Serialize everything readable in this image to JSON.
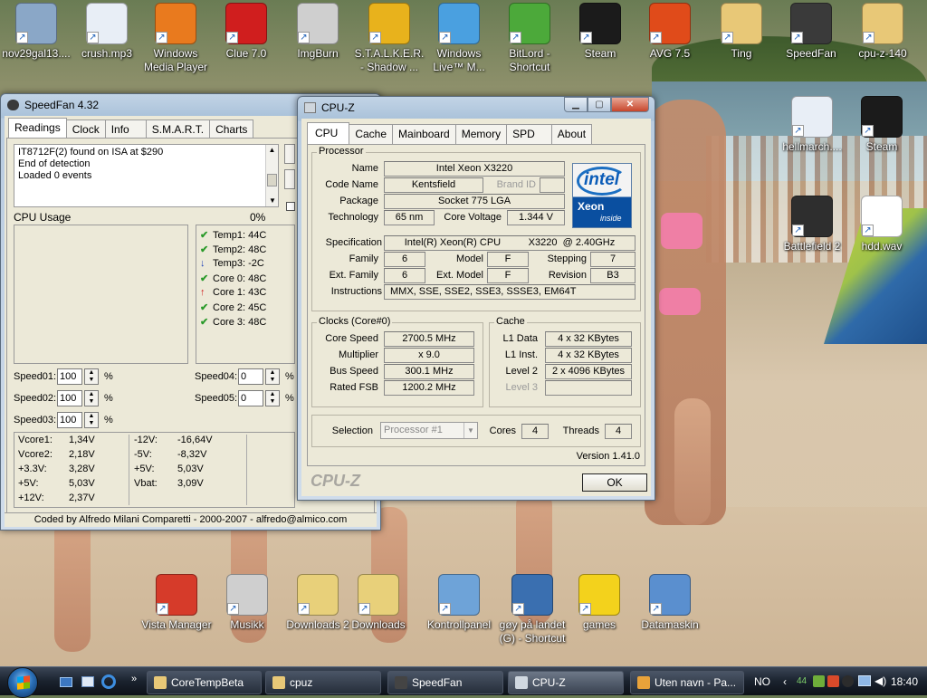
{
  "desktop_icons_top": [
    {
      "label": "nov29gal13....",
      "icon": "image-icon",
      "color": "#8aa7c7"
    },
    {
      "label": "crush.mp3",
      "icon": "audio-file-icon",
      "color": "#e8eef6"
    },
    {
      "label": "Windows Media Player",
      "icon": "media-player-icon",
      "color": "#e97a1e"
    },
    {
      "label": "Clue 7.0",
      "icon": "clue-icon",
      "color": "#d01e1e"
    },
    {
      "label": "ImgBurn",
      "icon": "disc-icon",
      "color": "#cfcfcf"
    },
    {
      "label": "S.T.A.L.K.E.R. - Shadow ...",
      "icon": "stalker-icon",
      "color": "#e8b21c"
    },
    {
      "label": "Windows Live™ M...",
      "icon": "messenger-icon",
      "color": "#4aa0e0"
    },
    {
      "label": "BitLord - Shortcut",
      "icon": "bitlord-icon",
      "color": "#4ca93a"
    },
    {
      "label": "Steam",
      "icon": "steam-icon",
      "color": "#1b1b1b"
    },
    {
      "label": "AVG 7.5",
      "icon": "avg-icon",
      "color": "#e04b1a"
    },
    {
      "label": "Ting",
      "icon": "folder-icon",
      "color": "#e8c877"
    },
    {
      "label": "SpeedFan",
      "icon": "speedfan-icon",
      "color": "#3a3a3a"
    },
    {
      "label": "cpu-z-140",
      "icon": "folder-icon",
      "color": "#e8c877"
    }
  ],
  "desktop_icons_right": [
    {
      "label": "hellmarch....",
      "icon": "audio-file-icon",
      "color": "#e8eef6"
    },
    {
      "label": "Steam",
      "icon": "steam-icon",
      "color": "#1b1b1b"
    },
    {
      "label": "Battlefield 2",
      "icon": "battlefield-icon",
      "color": "#2e2e2e"
    },
    {
      "label": "hdd.wav",
      "icon": "wav-file-icon",
      "color": "#ffffff"
    }
  ],
  "desktop_icons_bottom": [
    {
      "label": "Vista Manager",
      "icon": "tools-icon",
      "color": "#d63b2a"
    },
    {
      "label": "Musikk",
      "icon": "speaker-icon",
      "color": "#cfcfcf"
    },
    {
      "label": "Downloads 2",
      "icon": "folder-icon",
      "color": "#e8d07a"
    },
    {
      "label": "Downloads",
      "icon": "folder-icon",
      "color": "#e8d07a"
    },
    {
      "label": "Kontrollpanel",
      "icon": "control-panel-icon",
      "color": "#6ea3d8"
    },
    {
      "label": "gøy på landet (G) - Shortcut",
      "icon": "drive-icon",
      "color": "#3a6fb0"
    },
    {
      "label": "games",
      "icon": "star-icon",
      "color": "#f3d21c"
    },
    {
      "label": "Datamaskin",
      "icon": "computer-icon",
      "color": "#5a8fcf"
    }
  ],
  "speedfan": {
    "title": "SpeedFan 4.32",
    "tabs": [
      "Readings",
      "Clock",
      "Info",
      "S.M.A.R.T.",
      "Charts"
    ],
    "log": [
      "IT8712F(2) found on ISA at $290",
      "End of detection",
      "Loaded 0 events"
    ],
    "cpu_usage_label": "CPU Usage",
    "cpu_usage_value": "0%",
    "temps": [
      {
        "label": "Temp1:",
        "value": "44C",
        "status": "ok"
      },
      {
        "label": "Temp2:",
        "value": "48C",
        "status": "ok"
      },
      {
        "label": "Temp3:",
        "value": "-2C",
        "status": "down"
      },
      {
        "label": "Core 0:",
        "value": "48C",
        "status": "ok"
      },
      {
        "label": "Core 1:",
        "value": "43C",
        "status": "up"
      },
      {
        "label": "Core 2:",
        "value": "45C",
        "status": "ok"
      },
      {
        "label": "Core 3:",
        "value": "48C",
        "status": "ok"
      }
    ],
    "speeds": [
      {
        "label": "Speed01:",
        "value": "100"
      },
      {
        "label": "Speed02:",
        "value": "100"
      },
      {
        "label": "Speed03:",
        "value": "100"
      },
      {
        "label": "Speed04:",
        "value": "0"
      },
      {
        "label": "Speed05:",
        "value": "0"
      }
    ],
    "percent_sign": "%",
    "voltages_left": [
      {
        "label": "Vcore1:",
        "value": "1,34V"
      },
      {
        "label": "Vcore2:",
        "value": "2,18V"
      },
      {
        "label": "+3.3V:",
        "value": "3,28V"
      },
      {
        "label": "+5V:",
        "value": "5,03V"
      },
      {
        "label": "+12V:",
        "value": "2,37V"
      }
    ],
    "voltages_right": [
      {
        "label": "-12V:",
        "value": "-16,64V"
      },
      {
        "label": "-5V:",
        "value": "-8,32V"
      },
      {
        "label": "+5V:",
        "value": "5,03V"
      },
      {
        "label": "Vbat:",
        "value": "3,09V"
      }
    ],
    "footer": "Coded by Alfredo Milani Comparetti - 2000-2007 - alfredo@almico.com"
  },
  "cpuz": {
    "title": "CPU-Z",
    "tabs": [
      "CPU",
      "Cache",
      "Mainboard",
      "Memory",
      "SPD",
      "About"
    ],
    "processor_group": "Processor",
    "name_label": "Name",
    "name": "Intel Xeon X3220",
    "codename_label": "Code Name",
    "codename": "Kentsfield",
    "brandid_label": "Brand ID",
    "brandid": "",
    "package_label": "Package",
    "package": "Socket 775 LGA",
    "technology_label": "Technology",
    "technology": "65 nm",
    "core_voltage_label": "Core Voltage",
    "core_voltage": "1.344 V",
    "spec_label": "Specification",
    "spec": "Intel(R) Xeon(R) CPU          X3220  @ 2.40GHz",
    "family_label": "Family",
    "family": "6",
    "model_label": "Model",
    "model": "F",
    "stepping_label": "Stepping",
    "stepping": "7",
    "ext_family_label": "Ext. Family",
    "ext_family": "6",
    "ext_model_label": "Ext. Model",
    "ext_model": "F",
    "revision_label": "Revision",
    "revision": "B3",
    "instructions_label": "Instructions",
    "instructions": "MMX, SSE, SSE2, SSE3, SSSE3, EM64T",
    "logo": {
      "brand": "intel",
      "line1": "Xeon",
      "line2": "inside"
    },
    "clocks_group": "Clocks (Core#0)",
    "core_speed_label": "Core Speed",
    "core_speed": "2700.5 MHz",
    "multiplier_label": "Multiplier",
    "multiplier": "x 9.0",
    "bus_speed_label": "Bus Speed",
    "bus_speed": "300.1 MHz",
    "rated_fsb_label": "Rated FSB",
    "rated_fsb": "1200.2 MHz",
    "cache_group": "Cache",
    "l1d_label": "L1 Data",
    "l1d": "4 x 32 KBytes",
    "l1i_label": "L1 Inst.",
    "l1i": "4 x 32 KBytes",
    "l2_label": "Level 2",
    "l2": "2 x 4096 KBytes",
    "l3_label": "Level 3",
    "l3": "",
    "selection_label": "Selection",
    "selection": "Processor #1",
    "cores_label": "Cores",
    "cores": "4",
    "threads_label": "Threads",
    "threads": "4",
    "version": "Version 1.41.0",
    "brand_watermark": "CPU-Z",
    "ok": "OK"
  },
  "taskbar": {
    "buttons": [
      {
        "label": "CoreTempBeta",
        "color": "#e8c877",
        "active": false
      },
      {
        "label": "cpuz",
        "color": "#e8c877",
        "active": false
      },
      {
        "label": "SpeedFan",
        "color": "#444444",
        "active": false
      },
      {
        "label": "CPU-Z",
        "color": "#d0d8e0",
        "active": true
      },
      {
        "label": "Uten navn - Pa...",
        "color": "#e8a23a",
        "active": false
      }
    ],
    "language": "NO",
    "tray_temp": "44",
    "clock": "18:40"
  }
}
